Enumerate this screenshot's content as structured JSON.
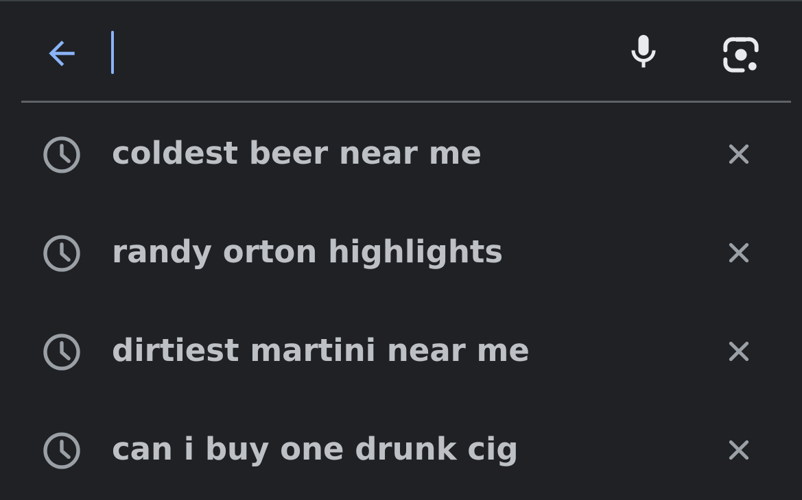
{
  "search": {
    "value": "",
    "placeholder": ""
  },
  "icons": {
    "back": "arrow-back-icon",
    "mic": "mic-icon",
    "lens": "lens-camera-icon",
    "history": "history-clock-icon",
    "remove": "close-icon"
  },
  "colors": {
    "background": "#202124",
    "accent": "#8ab4f8",
    "text": "#bdc1c6",
    "icon": "#9aa0a6",
    "divider": "#5f6368"
  },
  "suggestions": [
    {
      "text": "coldest beer near me"
    },
    {
      "text": "randy orton highlights"
    },
    {
      "text": "dirtiest martini near me"
    },
    {
      "text": "can i buy one drunk cig"
    }
  ]
}
